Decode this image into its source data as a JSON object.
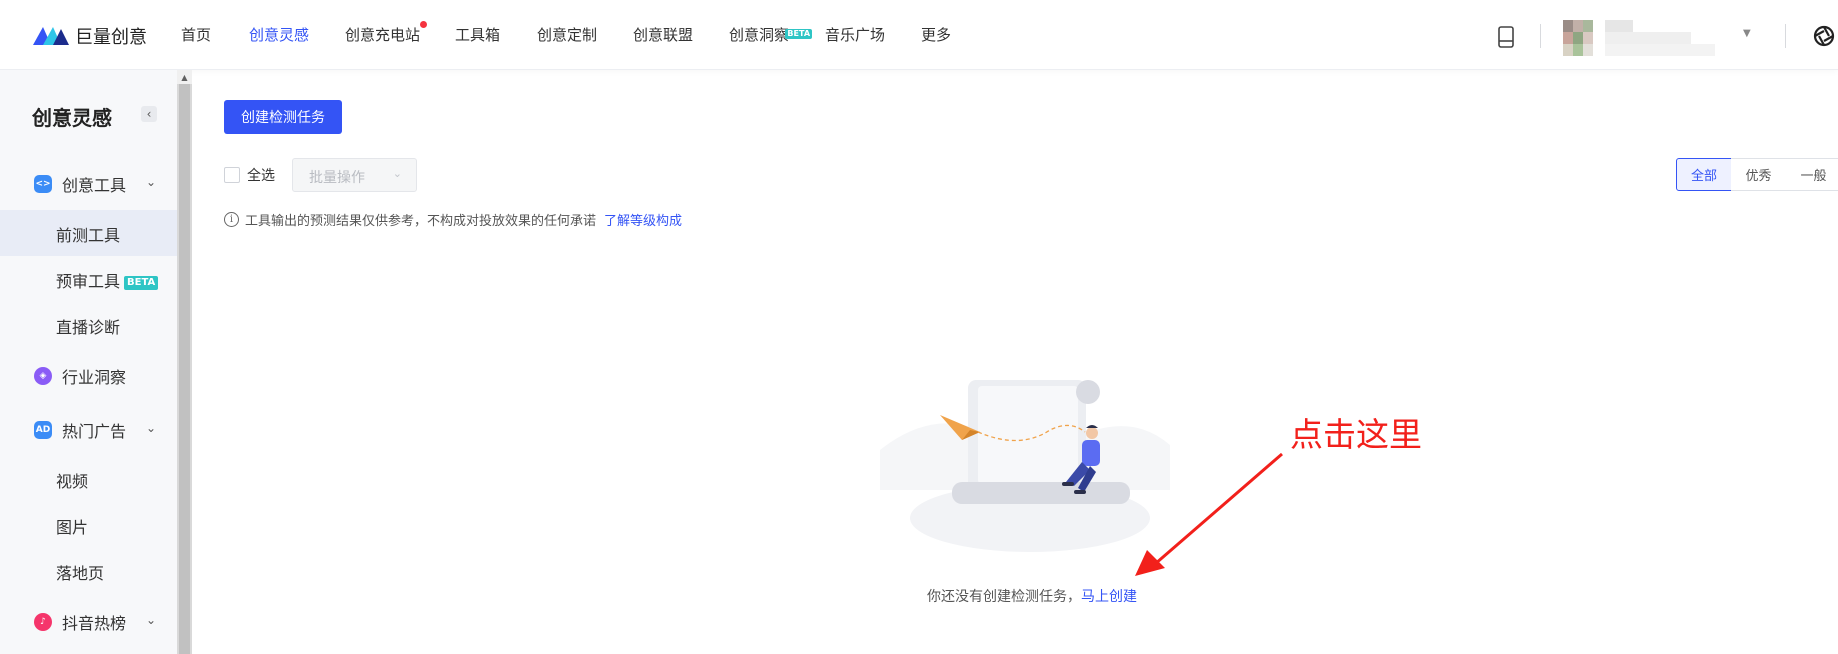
{
  "brand": {
    "name": "巨量创意"
  },
  "nav": {
    "items": [
      {
        "label": "首页",
        "active": false
      },
      {
        "label": "创意灵感",
        "active": true
      },
      {
        "label": "创意充电站",
        "active": false
      },
      {
        "label": "工具箱",
        "active": false
      },
      {
        "label": "创意定制",
        "active": false
      },
      {
        "label": "创意联盟",
        "active": false
      },
      {
        "label": "创意洞察",
        "active": false
      },
      {
        "label": "音乐广场",
        "active": false
      },
      {
        "label": "更多",
        "active": false
      }
    ],
    "beta_badge": "BETA"
  },
  "sidebar": {
    "title": "创意灵感",
    "groups": [
      {
        "label": "创意工具",
        "icon": "code-tool-icon",
        "color": "#3b8cf6",
        "expanded": true,
        "subs": [
          {
            "label": "前测工具",
            "active": true
          },
          {
            "label": "预审工具",
            "badge": "BETA"
          },
          {
            "label": "直播诊断"
          }
        ]
      },
      {
        "label": "行业洞察",
        "icon": "compass-icon",
        "color": "#8a5cf6"
      },
      {
        "label": "热门广告",
        "icon": "ad-icon",
        "color": "#3b8cf6",
        "icon_text": "AD",
        "expanded": true,
        "subs": [
          {
            "label": "视频"
          },
          {
            "label": "图片"
          },
          {
            "label": "落地页"
          }
        ]
      },
      {
        "label": "抖音热榜",
        "icon": "tiktok-icon",
        "color": "#f5356b"
      }
    ]
  },
  "toolbar": {
    "create_button": "创建检测任务",
    "select_all": "全选",
    "batch_placeholder": "批量操作"
  },
  "filters": {
    "segments": [
      "全部",
      "优秀",
      "一般"
    ],
    "selected": "全部"
  },
  "notice": {
    "text": "工具输出的预测结果仅供参考，不构成对投放效果的任何承诺",
    "link": "了解等级构成"
  },
  "empty_state": {
    "text": "你还没有创建检测任务，",
    "link": "马上创建"
  },
  "annotation": {
    "text": "点击这里",
    "color": "#f2201b"
  },
  "colors": {
    "accent": "#3454f5",
    "sidebar_bg": "#f7f8fa"
  }
}
